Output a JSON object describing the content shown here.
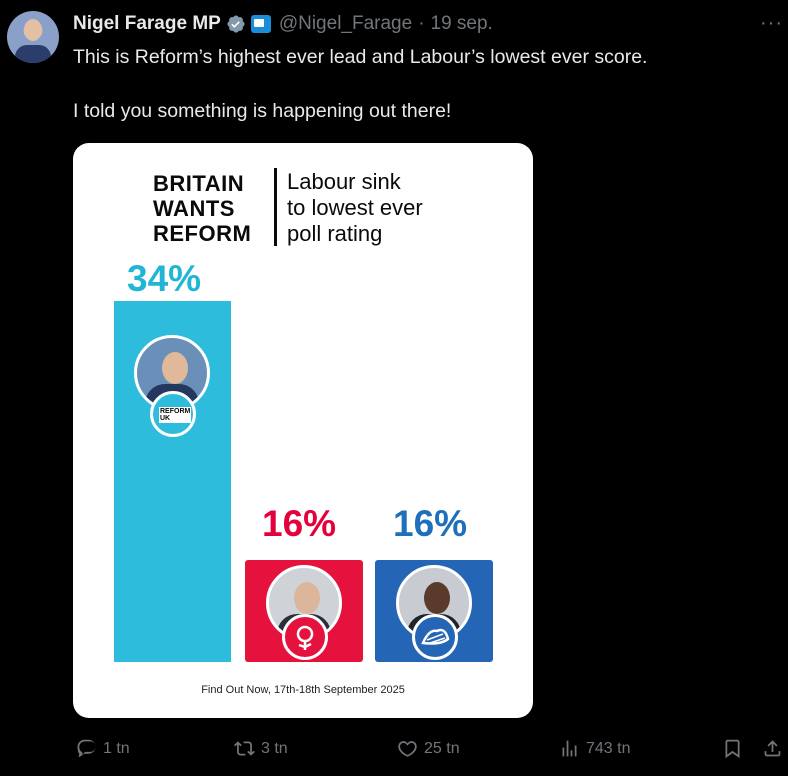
{
  "author": {
    "name": "Nigel Farage MP",
    "handle": "@Nigel_Farage",
    "separator": "·",
    "date": "19 sep."
  },
  "more_label": "···",
  "tweet": {
    "line1": "This is Reform’s highest ever lead and Labour’s lowest ever score.",
    "line2": "I told you something is happening out there!"
  },
  "graphic": {
    "brand_lines": [
      "BRITAIN",
      "WANTS",
      "REFORM"
    ],
    "headline_lines": [
      "Labour sink",
      "to lowest ever",
      "poll rating"
    ],
    "reform_badge_text": [
      "REFORM",
      "UK"
    ],
    "source": "Find Out Now, 17th-18th September 2025"
  },
  "chart_data": {
    "type": "bar",
    "categories": [
      "Reform UK",
      "Labour",
      "Conservatives"
    ],
    "values": [
      34,
      16,
      16
    ],
    "value_labels": [
      "34%",
      "16%",
      "16%"
    ],
    "title": "Labour sink to lowest ever poll rating",
    "colors": [
      "#2ebcdd",
      "#e5123e",
      "#2465b5"
    ]
  },
  "actions": {
    "reply": "1 tn",
    "retweet": "3 tn",
    "like": "25 tn",
    "views": "743 tn"
  },
  "icons": [
    "verified-badge-icon",
    "affiliation-icon",
    "more-icon",
    "reply-icon",
    "retweet-icon",
    "like-icon",
    "views-icon",
    "bookmark-icon",
    "share-icon"
  ],
  "colors": {
    "background": "#000000",
    "text": "#e7e9ea",
    "muted": "#71767b",
    "verified": "#829aab"
  }
}
